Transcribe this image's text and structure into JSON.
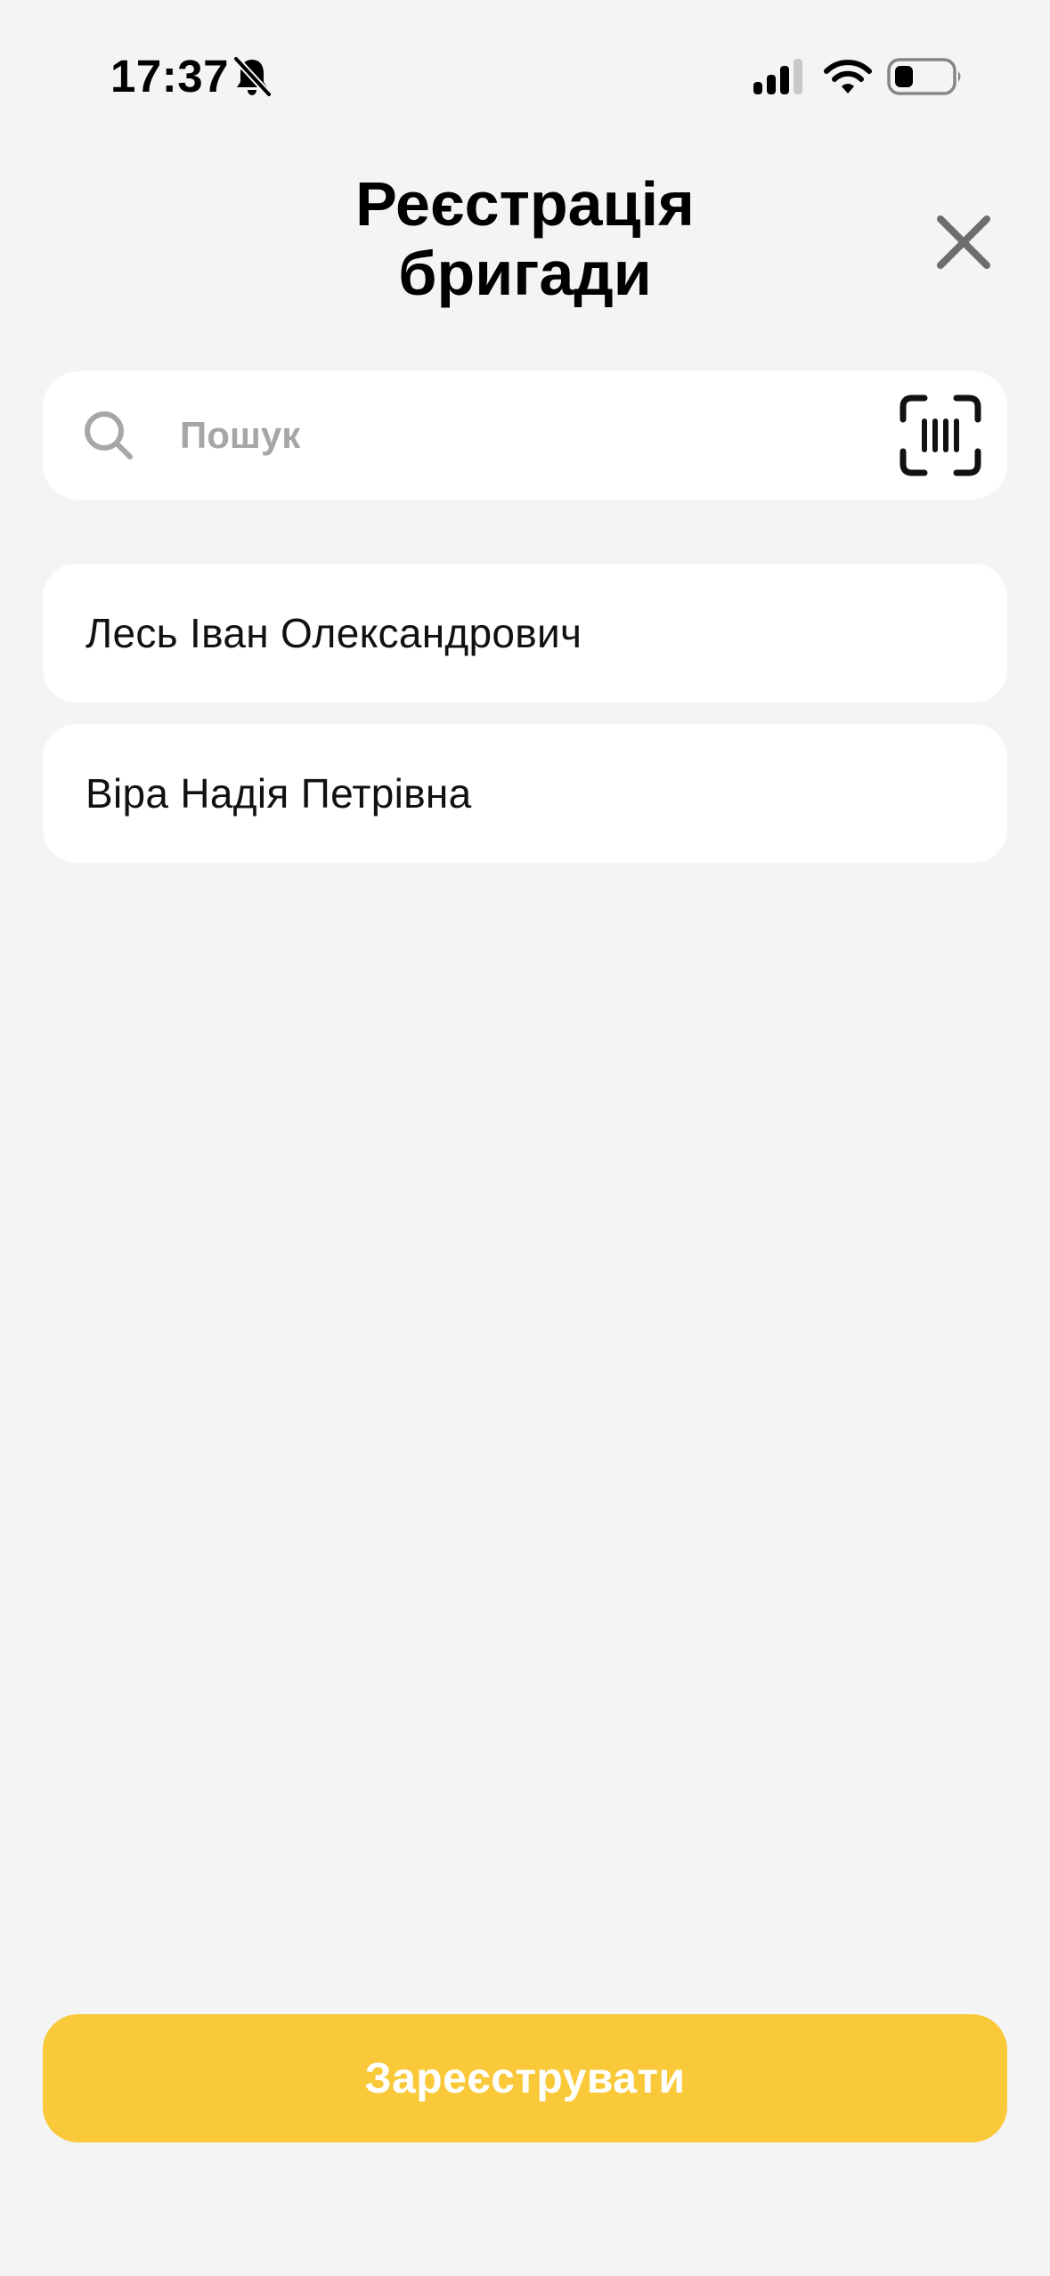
{
  "status_bar": {
    "time": "17:37",
    "icons": [
      "bell-slash-icon",
      "cellular-signal-icon",
      "wifi-icon",
      "battery-icon"
    ]
  },
  "header": {
    "title": "Реєстрація\nбригади",
    "close_icon": "close-icon"
  },
  "search": {
    "placeholder": "Пошук",
    "value": "",
    "icon": "search-icon",
    "scan_icon": "barcode-scan-icon"
  },
  "members": [
    {
      "label": "Лесь Іван Олександрович"
    },
    {
      "label": "Віра Надія Петрівна"
    }
  ],
  "footer": {
    "register_label": "Зареєструвати"
  },
  "colors": {
    "background": "#F4F4F4",
    "card": "#FFFFFF",
    "accent": "#F9C93A",
    "placeholder": "#A6A6A6",
    "icon_gray": "#6E6E6E"
  }
}
